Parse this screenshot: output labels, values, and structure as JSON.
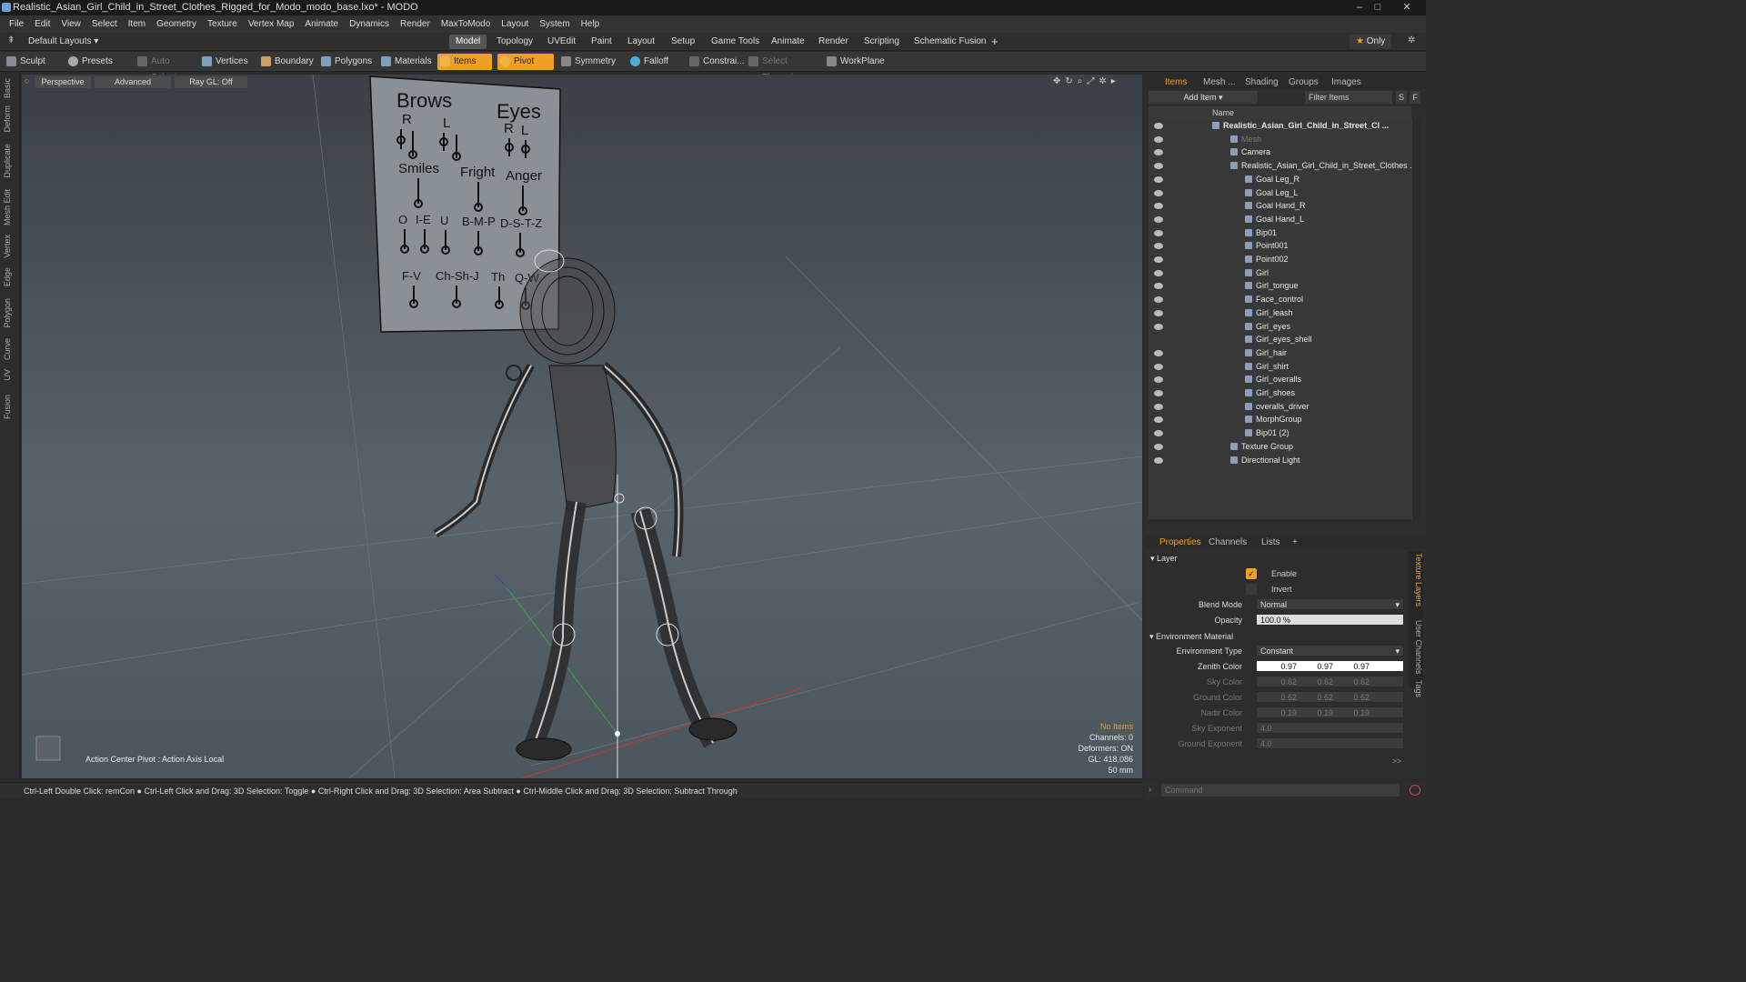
{
  "window": {
    "title": "Realistic_Asian_Girl_Child_in_Street_Clothes_Rigged_for_Modo_modo_base.lxo* - MODO",
    "controls": [
      "–",
      "□",
      "✕"
    ]
  },
  "menu": [
    "File",
    "Edit",
    "View",
    "Select",
    "Item",
    "Geometry",
    "Texture",
    "Vertex Map",
    "Animate",
    "Dynamics",
    "Render",
    "MaxToModo",
    "Layout",
    "System",
    "Help"
  ],
  "layoutbar": {
    "layout_select": "Default Layouts",
    "tabs": [
      "Model",
      "Topology",
      "UVEdit",
      "Paint",
      "Layout",
      "Setup",
      "Game Tools",
      "Animate",
      "Render",
      "Scripting",
      "Schematic Fusion"
    ],
    "active_tab": "Model",
    "plus": "+",
    "only_label": "Only",
    "star": "★"
  },
  "toolbar": {
    "sculpt": "Sculpt",
    "presets": "Presets",
    "auto_select": "Auto Select",
    "vertices": "Vertices",
    "boundary": "Boundary",
    "polygons": "Polygons",
    "materials": "Materials",
    "items": "Items",
    "pivot": "Pivot",
    "symmetry": "Symmetry",
    "falloff": "Falloff",
    "constrain": "Constrai...",
    "select_through": "Select Through",
    "workplane": "WorkPlane"
  },
  "lefttabs": [
    "Basic",
    "Deform",
    "Duplicate",
    "Mesh Edit",
    "Vertex",
    "Edge",
    "Polygon",
    "Curve",
    "UV",
    "Fusion"
  ],
  "viewport": {
    "view_mode": "Perspective",
    "shading": "Advanced",
    "raygl": "Ray GL: Off",
    "action_center": "Action Center Pivot : Action Axis Local",
    "hud": {
      "no_items": "No Items",
      "channels": "Channels: 0",
      "deformers": "Deformers: ON",
      "gl": "GL: 418,086",
      "scale": "50 mm"
    },
    "face_board": {
      "brows": "Brows",
      "eyes": "Eyes",
      "r1": "R",
      "l1": "L",
      "r2": "R",
      "l2": "L",
      "smiles": "Smiles",
      "fright": "Fright",
      "anger": "Anger",
      "o": "O",
      "ie": "I-E",
      "u": "U",
      "bmp": "B-M-P",
      "dstz": "D-S-T-Z",
      "fv": "F-V",
      "chshj": "Ch-Sh-J",
      "th": "Th",
      "qw": "Q-W"
    }
  },
  "items_panel": {
    "tabs": [
      "Items",
      "Mesh ...",
      "Shading",
      "Groups",
      "Images"
    ],
    "active_tab": "Items",
    "add_item": "Add Item",
    "filter_items": "Filter Items",
    "s_btn": "S",
    "f_btn": "F",
    "col_name": "Name",
    "tree": [
      {
        "label": "Realistic_Asian_Girl_Child_in_Street_Cl ...",
        "indent": 0,
        "bold": true,
        "eye": true
      },
      {
        "label": "Mesh",
        "indent": 1,
        "dim": true,
        "eye": true
      },
      {
        "label": "Camera",
        "indent": 1,
        "eye": true
      },
      {
        "label": "Realistic_Asian_Girl_Child_in_Street_Clothes ...",
        "indent": 1,
        "eye": true
      },
      {
        "label": "Goal Leg_R",
        "indent": 2,
        "eye": true
      },
      {
        "label": "Goal Leg_L",
        "indent": 2,
        "eye": true
      },
      {
        "label": "Goal Hand_R",
        "indent": 2,
        "eye": true
      },
      {
        "label": "Goal Hand_L",
        "indent": 2,
        "eye": true
      },
      {
        "label": "Bip01",
        "indent": 2,
        "eye": true
      },
      {
        "label": "Point001",
        "indent": 2,
        "eye": true
      },
      {
        "label": "Point002",
        "indent": 2,
        "eye": true
      },
      {
        "label": "Girl",
        "indent": 2,
        "eye": true
      },
      {
        "label": "Girl_tongue",
        "indent": 2,
        "eye": true
      },
      {
        "label": "Face_control",
        "indent": 2,
        "eye": true
      },
      {
        "label": "Girl_leash",
        "indent": 2,
        "eye": true
      },
      {
        "label": "Girl_eyes",
        "indent": 2,
        "eye": true
      },
      {
        "label": "Girl_eyes_shell",
        "indent": 2,
        "eye": false
      },
      {
        "label": "Girl_hair",
        "indent": 2,
        "eye": true
      },
      {
        "label": "Girl_shirt",
        "indent": 2,
        "eye": true
      },
      {
        "label": "Girl_overalls",
        "indent": 2,
        "eye": true
      },
      {
        "label": "Girl_shoes",
        "indent": 2,
        "eye": true
      },
      {
        "label": "overalls_driver",
        "indent": 2,
        "eye": true
      },
      {
        "label": "MorphGroup",
        "indent": 2,
        "eye": true
      },
      {
        "label": "Bip01 (2)",
        "indent": 2,
        "eye": true
      },
      {
        "label": "Texture Group",
        "indent": 1,
        "eye": true
      },
      {
        "label": "Directional Light",
        "indent": 1,
        "eye": true
      }
    ]
  },
  "props_panel": {
    "tabs": [
      "Properties",
      "Channels",
      "Lists"
    ],
    "active_tab": "Properties",
    "plus": "+",
    "section_layer": "Layer",
    "enable": "Enable",
    "invert": "Invert",
    "blend_mode_label": "Blend Mode",
    "blend_mode": "Normal",
    "opacity_label": "Opacity",
    "opacity": "100.0 %",
    "section_env": "Environment Material",
    "env_type_label": "Environment Type",
    "env_type": "Constant",
    "zenith_label": "Zenith Color",
    "zenith": [
      "0.97",
      "0.97",
      "0.97"
    ],
    "sky_label": "Sky Color",
    "sky": [
      "0.62",
      "0.62",
      "0.62"
    ],
    "ground_label": "Ground Color",
    "ground": [
      "0.62",
      "0.62",
      "0.62"
    ],
    "nadir_label": "Nadir Color",
    "nadir": [
      "0.19",
      "0.19",
      "0.19"
    ],
    "sky_exp_label": "Sky Exponent",
    "sky_exp": "4.0",
    "ground_exp_label": "Ground Exponent",
    "ground_exp": "4.0",
    "more": ">>",
    "side_tabs": [
      "Texture Layers",
      "User Channels",
      "Tags"
    ]
  },
  "command": {
    "placeholder": "Command"
  },
  "status": "Ctrl-Left Double Click: remCon ● Ctrl-Left Click and Drag: 3D Selection: Toggle ● Ctrl-Right Click and Drag: 3D Selection: Area Subtract ● Ctrl-Middle Click and Drag: 3D Selection: Subtract Through",
  "colors": {
    "accent": "#f0a020",
    "panel": "#2d2d2d",
    "viewport_top": "#3a4045"
  }
}
